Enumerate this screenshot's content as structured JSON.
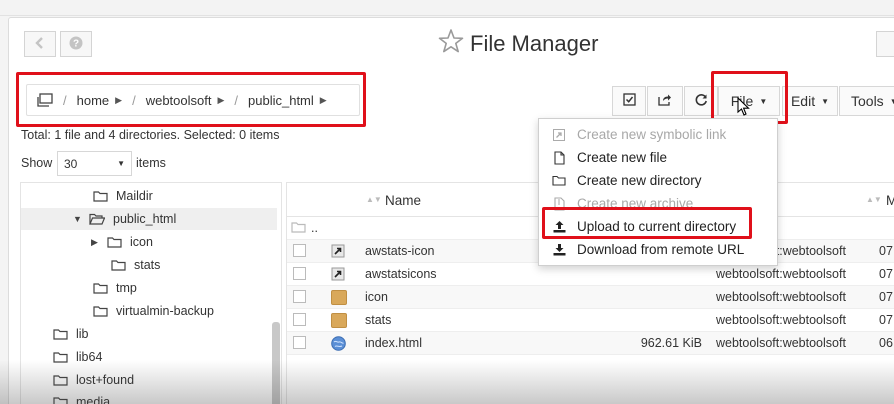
{
  "app": {
    "title": "File Manager"
  },
  "breadcrumb": {
    "items": [
      "home",
      "webtoolsoft",
      "public_html"
    ]
  },
  "toolbar": {
    "file_label": "File",
    "edit_label": "Edit",
    "tools_label": "Tools"
  },
  "summary": {
    "text": "Total: 1 file and 4 directories. Selected: 0 items"
  },
  "pagination": {
    "show_label": "Show",
    "page_size": "30",
    "items_label": "items"
  },
  "tree": {
    "items": [
      {
        "label": "Maildir"
      },
      {
        "label": "public_html"
      },
      {
        "label": "icon"
      },
      {
        "label": "stats"
      },
      {
        "label": "tmp"
      },
      {
        "label": "virtualmin-backup"
      },
      {
        "label": "lib"
      },
      {
        "label": "lib64"
      },
      {
        "label": "lost+found"
      },
      {
        "label": "media"
      }
    ]
  },
  "files": {
    "columns": {
      "name": "Name",
      "modified": "M"
    },
    "parent": "..",
    "rows": [
      {
        "name": "awstats-icon",
        "size": "",
        "owner": "webtoolsoft:webtoolsoft",
        "date": "07"
      },
      {
        "name": "awstatsicons",
        "size": "",
        "owner": "webtoolsoft:webtoolsoft",
        "date": "07"
      },
      {
        "name": "icon",
        "size": "",
        "owner": "webtoolsoft:webtoolsoft",
        "date": "07"
      },
      {
        "name": "stats",
        "size": "",
        "owner": "webtoolsoft:webtoolsoft",
        "date": "07"
      },
      {
        "name": "index.html",
        "size": "962.61 KiB",
        "owner": "webtoolsoft:webtoolsoft",
        "date": "06"
      }
    ]
  },
  "file_menu": {
    "items": [
      {
        "label": "Create new symbolic link",
        "icon": "symlink-icon",
        "disabled": true
      },
      {
        "label": "Create new file",
        "icon": "file-icon",
        "disabled": false
      },
      {
        "label": "Create new directory",
        "icon": "folder-icon",
        "disabled": false
      },
      {
        "label": "Create new archive",
        "icon": "archive-icon",
        "disabled": true
      },
      {
        "label": "Upload to current directory",
        "icon": "upload-icon",
        "disabled": false
      },
      {
        "label": "Download from remote URL",
        "icon": "download-icon",
        "disabled": false
      }
    ]
  },
  "colors": {
    "highlight": "#e0101a",
    "folder": "#d9a85a"
  }
}
